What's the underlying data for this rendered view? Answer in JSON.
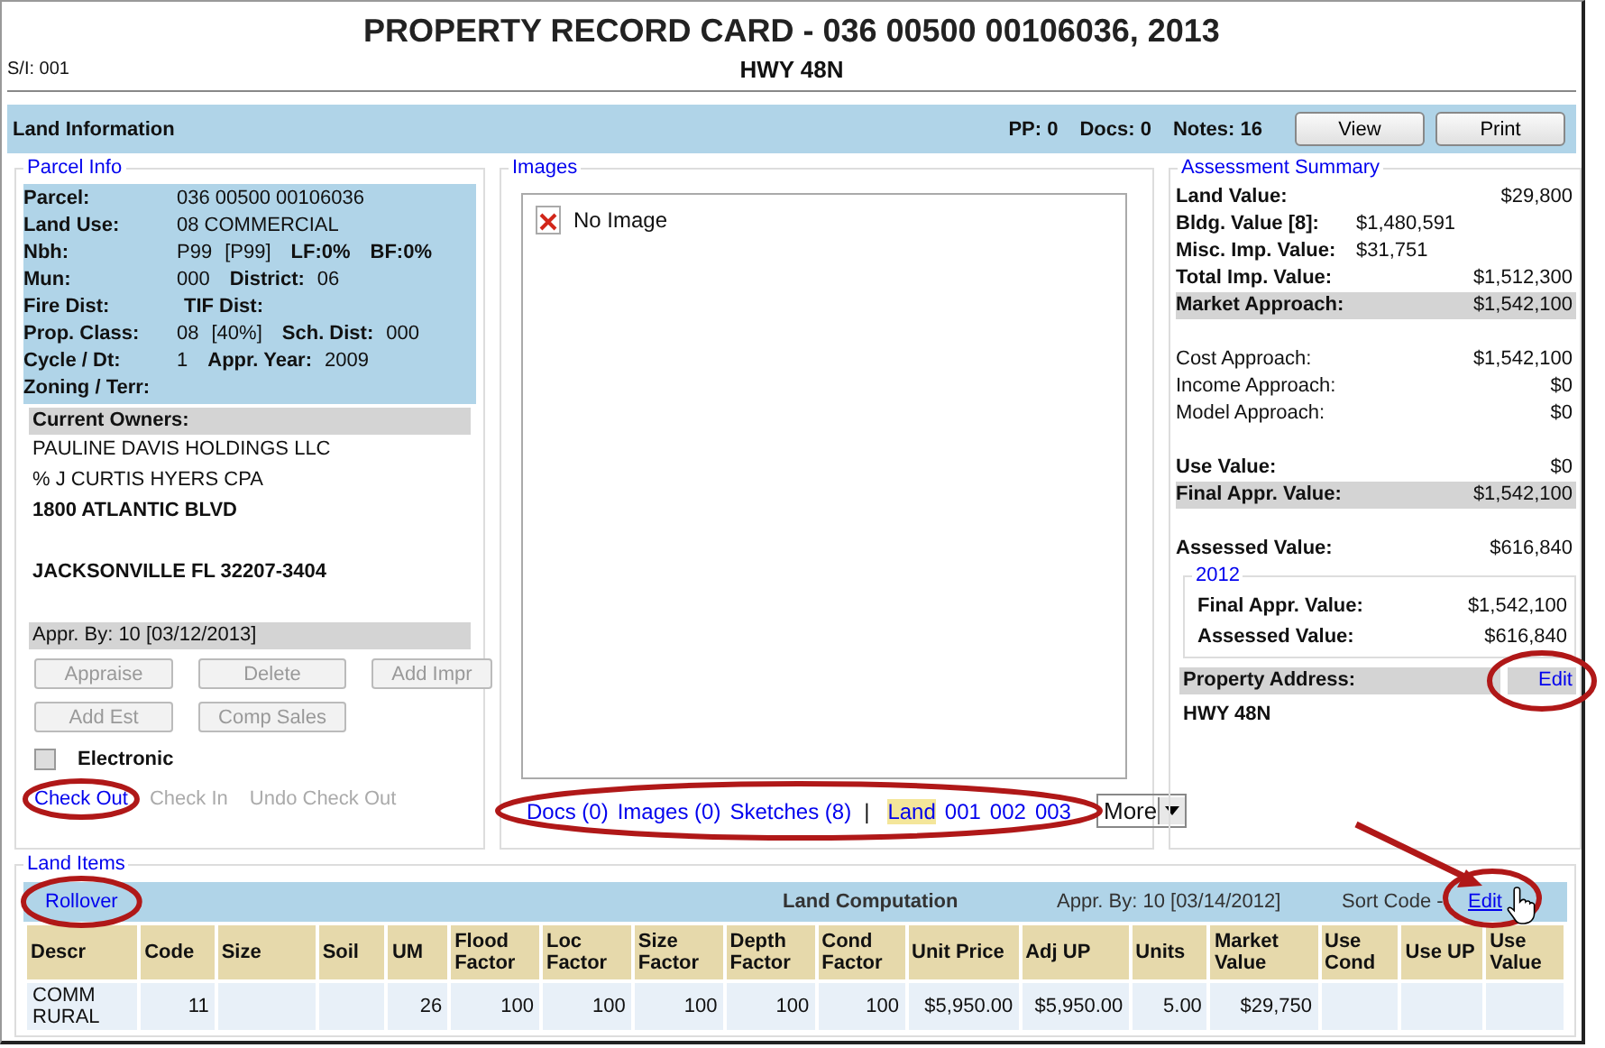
{
  "header": {
    "title": "PROPERTY RECORD CARD - 036 00500 00106036, 2013",
    "si": "S/I: 001",
    "subtitle": "HWY 48N"
  },
  "land_info_bar": {
    "title": "Land Information",
    "counters": [
      "PP: 0",
      "Docs: 0",
      "Notes: 16"
    ],
    "buttons": [
      "View",
      "Print"
    ]
  },
  "parcel_info": {
    "legend": "Parcel Info",
    "rows": [
      {
        "label": "Parcel:",
        "items": [
          {
            "kind": "value",
            "text": "036 00500 00106036"
          }
        ]
      },
      {
        "label": "Land Use:",
        "items": [
          {
            "kind": "value",
            "text": "08 COMMERCIAL"
          }
        ]
      },
      {
        "label": "Nbh:",
        "items": [
          {
            "kind": "value",
            "text": "P99"
          },
          {
            "kind": "value",
            "text": "[P99]"
          },
          {
            "kind": "label",
            "text": "LF:0%"
          },
          {
            "kind": "label",
            "text": "BF:0%"
          }
        ]
      },
      {
        "label": "Mun:",
        "items": [
          {
            "kind": "value",
            "text": "000"
          },
          {
            "kind": "label",
            "text": "District:"
          },
          {
            "kind": "value",
            "text": "06"
          }
        ]
      },
      {
        "label": "Fire Dist:",
        "items": [
          {
            "kind": "label",
            "text": "TIF Dist:"
          }
        ]
      },
      {
        "label": "Prop. Class:",
        "items": [
          {
            "kind": "value",
            "text": "08"
          },
          {
            "kind": "value",
            "text": "[40%]"
          },
          {
            "kind": "label",
            "text": "Sch. Dist:"
          },
          {
            "kind": "value",
            "text": "000"
          }
        ]
      },
      {
        "label": "Cycle / Dt:",
        "items": [
          {
            "kind": "value",
            "text": "1"
          },
          {
            "kind": "label",
            "text": "Appr. Year:"
          },
          {
            "kind": "value",
            "text": "2009"
          }
        ]
      },
      {
        "label": "Zoning / Terr:",
        "items": []
      }
    ],
    "owners_heading": "Current Owners:",
    "owner_blocks": [
      [
        {
          "text": "PAULINE DAVIS HOLDINGS LLC",
          "bold": false
        },
        {
          "text": "% J CURTIS HYERS CPA",
          "bold": false
        },
        {
          "text": "1800 ATLANTIC BLVD",
          "bold": true
        }
      ],
      [
        {
          "text": "JACKSONVILLE FL 32207-3404",
          "bold": true
        }
      ]
    ],
    "appr_by": "Appr. By: 10 [03/12/2013]",
    "buttons": [
      {
        "label": "Appraise",
        "disabled": true
      },
      {
        "label": "Delete",
        "disabled": true
      },
      {
        "label": "Add Impr",
        "disabled": true
      },
      {
        "label": "Add Est",
        "disabled": true
      },
      {
        "label": "Comp Sales",
        "disabled": true
      }
    ],
    "electronic": {
      "label": "Electronic",
      "checked": false
    },
    "checkout_links": [
      {
        "label": "Check Out",
        "disabled": false
      },
      {
        "label": "Check In",
        "disabled": true
      },
      {
        "label": "Undo Check Out",
        "disabled": true
      }
    ]
  },
  "images": {
    "legend": "Images",
    "placeholder": "No Image",
    "links": [
      {
        "kind": "link",
        "label": "Docs (0)"
      },
      {
        "kind": "link",
        "label": "Images (0)"
      },
      {
        "kind": "link",
        "label": "Sketches (8)"
      },
      {
        "kind": "separator",
        "label": "|"
      },
      {
        "kind": "tab",
        "label": "Land",
        "selected": true
      },
      {
        "kind": "tab",
        "label": "001",
        "selected": false
      },
      {
        "kind": "tab",
        "label": "002",
        "selected": false
      },
      {
        "kind": "tab",
        "label": "003",
        "selected": false
      }
    ],
    "more_select": "More"
  },
  "assessment": {
    "legend": "Assessment Summary",
    "row_groups": [
      [
        {
          "kind": "bold",
          "label": "Land Value:",
          "value": "$29,800"
        },
        {
          "kind": "inline",
          "label": "Bldg. Value  [8]:",
          "value": "$1,480,591"
        },
        {
          "kind": "inline",
          "label": "Misc. Imp. Value:",
          "value": "$31,751"
        },
        {
          "kind": "bold",
          "label": "Total Imp. Value:",
          "value": "$1,512,300"
        },
        {
          "kind": "shaded",
          "label": "Market Approach:",
          "value": "$1,542,100"
        }
      ],
      [
        {
          "kind": "plain",
          "label": "Cost Approach:",
          "value": "$1,542,100"
        },
        {
          "kind": "plain",
          "label": "Income Approach:",
          "value": "$0"
        },
        {
          "kind": "plain",
          "label": "Model Approach:",
          "value": "$0"
        }
      ],
      [
        {
          "kind": "bold",
          "label": "Use Value:",
          "value": "$0"
        },
        {
          "kind": "shaded",
          "label": "Final Appr. Value:",
          "value": "$1,542,100"
        }
      ],
      [
        {
          "kind": "bold",
          "label": "Assessed Value:",
          "value": "$616,840"
        }
      ]
    ],
    "prior": {
      "legend": "2012",
      "rows": [
        {
          "label": "Final Appr. Value:",
          "value": "$1,542,100"
        },
        {
          "label": "Assessed Value:",
          "value": "$616,840"
        }
      ]
    },
    "address_heading": "Property Address:",
    "address_edit": "Edit",
    "address": "HWY 48N"
  },
  "land_items": {
    "legend": "Land Items",
    "rollover": "Rollover",
    "computation": "Land Computation",
    "appr_by": "Appr. By: 10 [03/14/2012]",
    "sort_code": "Sort Code -",
    "edit": "Edit",
    "columns": [
      "Descr",
      "Code",
      "Size",
      "Soil",
      "UM",
      "Flood Factor",
      "Loc Factor",
      "Size Factor",
      "Depth Factor",
      "Cond Factor",
      "Unit Price",
      "Adj UP",
      "Units",
      "Market Value",
      "Use Cond",
      "Use UP",
      "Use Value"
    ],
    "rows": [
      [
        "COMM RURAL",
        "11",
        "",
        "",
        "26",
        "100",
        "100",
        "100",
        "100",
        "100",
        "$5,950.00",
        "$5,950.00",
        "5.00",
        "$29,750",
        "",
        "",
        ""
      ]
    ]
  }
}
